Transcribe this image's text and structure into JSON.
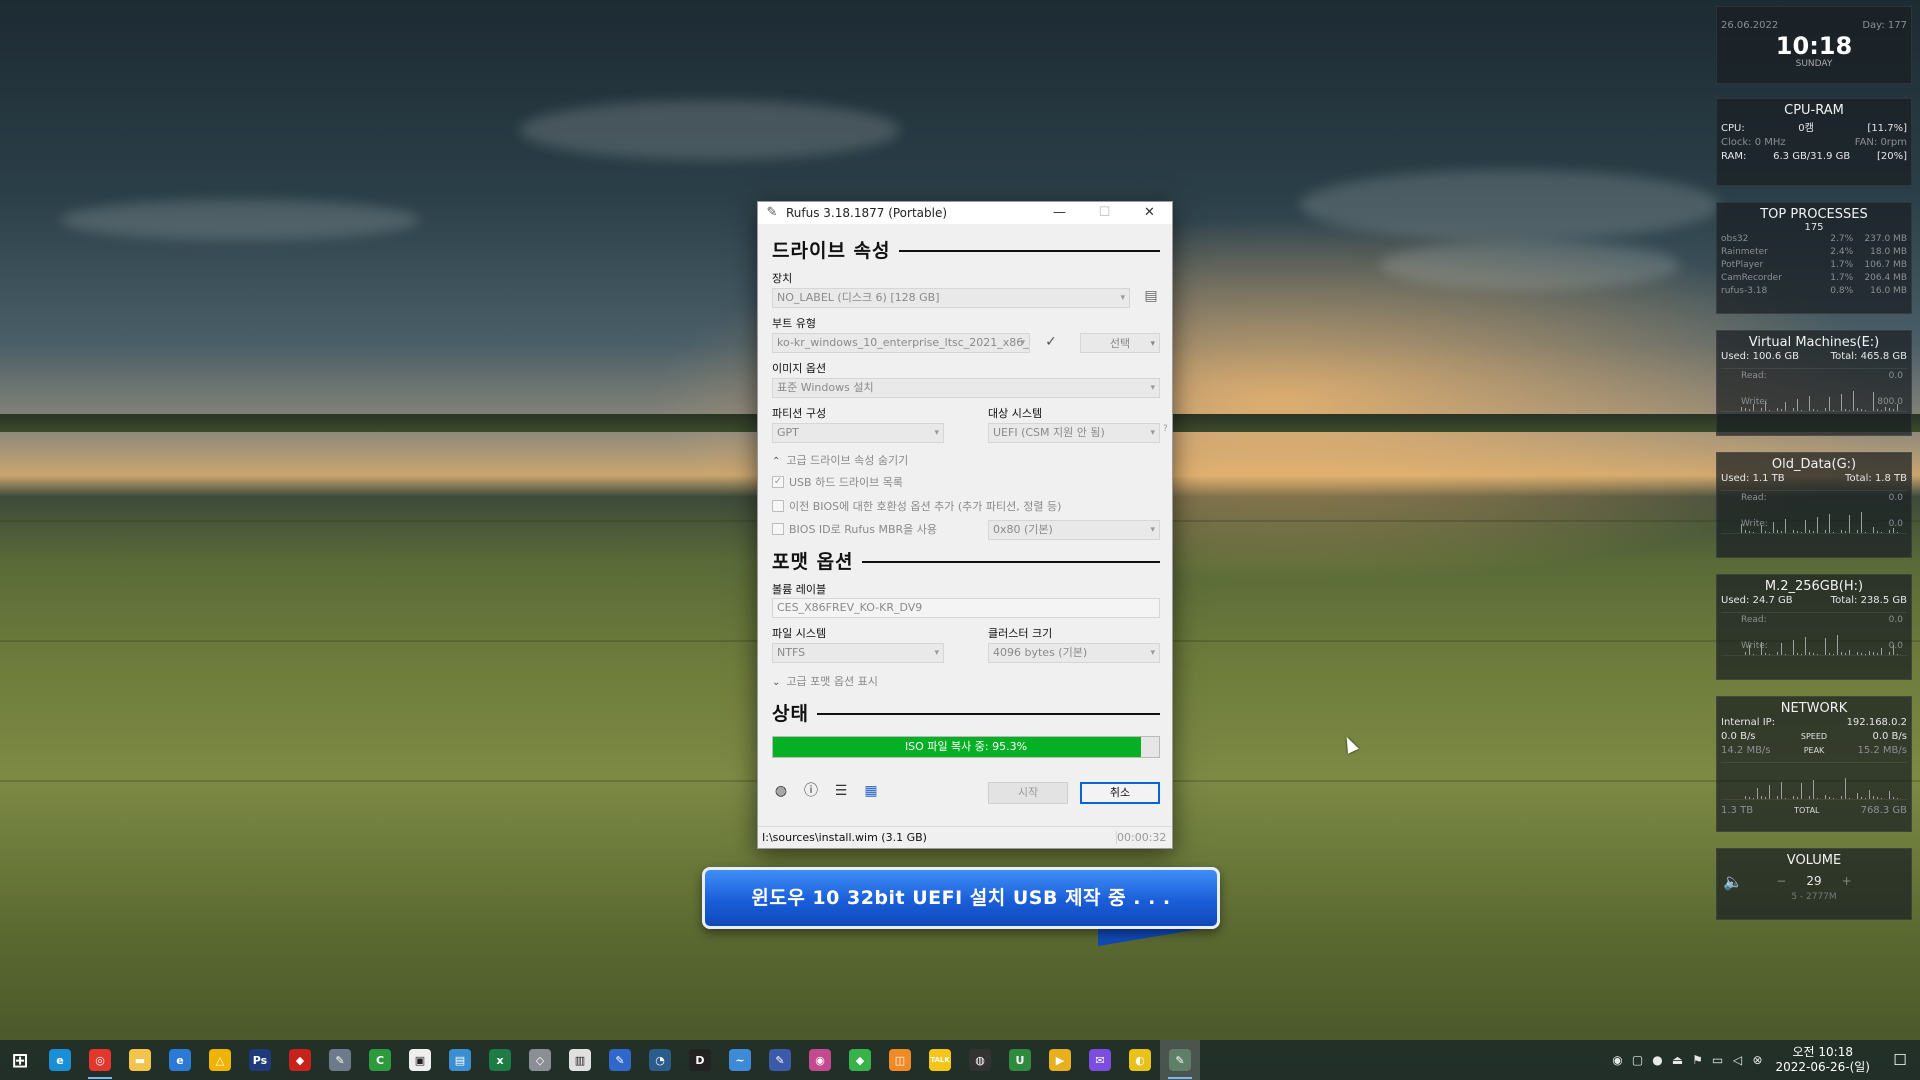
{
  "rufus": {
    "title": "Rufus 3.18.1877 (Portable)",
    "drive_section": "드라이브 속성",
    "device_label": "장치",
    "device_value": "NO_LABEL (디스크 6) [128 GB]",
    "boot_type_label": "부트 유형",
    "boot_type_value": "ko-kr_windows_10_enterprise_ltsc_2021_x86_",
    "select_button": "선택",
    "image_option_label": "이미지 옵션",
    "image_option_value": "표준 Windows 설치",
    "partition_label": "파티션 구성",
    "partition_value": "GPT",
    "target_label": "대상 시스템",
    "target_value": "UEFI (CSM 지원 안 됨)",
    "target_help": "?",
    "adv_drive_toggle": "고급 드라이브 속성 숨기기",
    "chk_usb_hdd": "USB 하드 드라이브 목록",
    "chk_bios_compat": "이전 BIOS에 대한 호환성 옵션 추가 (추가 파티션, 정렬 등)",
    "chk_rufus_mbr": "BIOS ID로 Rufus MBR을 사용",
    "bios_id_value": "0x80 (기본)",
    "format_section": "포맷 옵션",
    "volume_label": "볼륨 레이블",
    "volume_value": "CES_X86FREV_KO-KR_DV9",
    "fs_label": "파일 시스템",
    "fs_value": "NTFS",
    "cluster_label": "클러스터 크기",
    "cluster_value": "4096 bytes (기본)",
    "adv_format_toggle": "고급 포맷 옵션 표시",
    "status_section": "상태",
    "progress_text": "ISO 파일 복사 중: 95.3%",
    "progress_value": 0.953,
    "start_button": "시작",
    "cancel_button": "취소",
    "status_left": "I:\\sources\\install.wim (3.1 GB)",
    "status_time": "00:00:32",
    "usb_hdd_checked": true
  },
  "callout": {
    "text": "윈도우 10 32bit UEFI 설치 USB 제작 중 . . ."
  },
  "widgets": {
    "clock": {
      "date": "26.06.2022",
      "day_num": "Day: 177",
      "time": "10:18",
      "weekday": "SUNDAY"
    },
    "cpu_ram": {
      "title": "CPU-RAM",
      "cpu_label": "CPU:",
      "cpu_temp": "0캠",
      "cpu_pct": "[11.7%]",
      "clock": "Clock: 0 MHz",
      "fan": "FAN: 0rpm",
      "ram_label": "RAM:",
      "ram_value": "6.3 GB/31.9 GB",
      "ram_pct": "[20%]"
    },
    "top": {
      "title": "TOP PROCESSES",
      "count": "175",
      "rows": [
        {
          "name": "obs32",
          "cpu": "2.7%",
          "mem": "237.0 MB"
        },
        {
          "name": "Rainmeter",
          "cpu": "2.4%",
          "mem": "18.0 MB"
        },
        {
          "name": "PotPlayer",
          "cpu": "1.7%",
          "mem": "106.7 MB"
        },
        {
          "name": "CamRecorder",
          "cpu": "1.7%",
          "mem": "206.4 MB"
        },
        {
          "name": "rufus-3.18",
          "cpu": "0.8%",
          "mem": "16.0 MB"
        }
      ]
    },
    "disks": [
      {
        "title": "Virtual Machines(E:)",
        "used": "Used: 100.6 GB",
        "total": "Total: 465.8 GB",
        "read": "Read:",
        "read_val": "0.0",
        "write": "Write:",
        "write_val": "800.0"
      },
      {
        "title": "Old_Data(G:)",
        "used": "Used: 1.1 TB",
        "total": "Total: 1.8 TB",
        "read": "Read:",
        "read_val": "0.0",
        "write": "Write:",
        "write_val": "0.0"
      },
      {
        "title": "M.2_256GB(H:)",
        "used": "Used: 24.7 GB",
        "total": "Total: 238.5 GB",
        "read": "Read:",
        "read_val": "0.0",
        "write": "Write:",
        "write_val": "0.0"
      }
    ],
    "network": {
      "title": "NETWORK",
      "ip_label": "Internal IP:",
      "ip": "192.168.0.2",
      "down": "0.0 B/s",
      "speed": "SPEED",
      "up": "0.0 B/s",
      "down_peak": "14.2 MB/s",
      "peak": "PEAK",
      "up_peak": "15.2 MB/s",
      "total_down": "1.3 TB",
      "total": "TOTAL",
      "total_up": "768.3 GB"
    },
    "volume": {
      "title": "VOLUME",
      "minus": "−",
      "level": "29",
      "plus": "+",
      "device": "5 - 2777M"
    }
  },
  "taskbar": {
    "time": "오전 10:18",
    "date": "2022-06-26-(일)",
    "apps": [
      "start",
      "edge",
      "chrome",
      "explorer",
      "ie",
      "daum",
      "photoshop",
      "acrobat",
      "tool1",
      "camtasia",
      "editor",
      "media",
      "excel",
      "usb",
      "note",
      "pen",
      "planet",
      "dash",
      "fish",
      "pens",
      "atom",
      "green",
      "box",
      "kakaotalk",
      "obs",
      "u-app",
      "potplayer",
      "messenger",
      "wiz",
      "rufus"
    ]
  }
}
